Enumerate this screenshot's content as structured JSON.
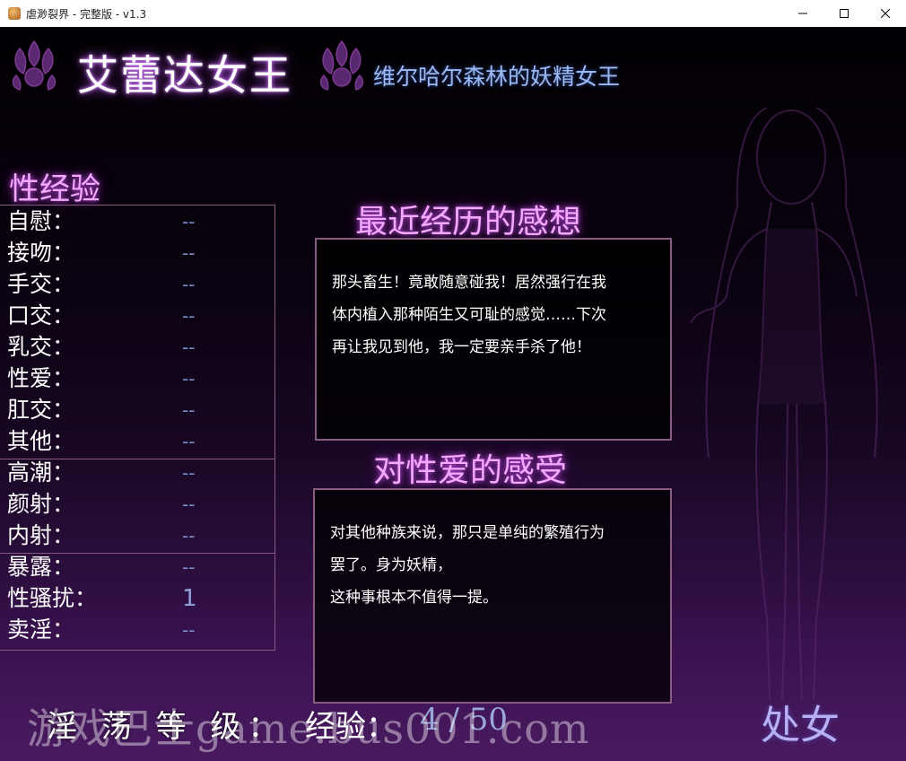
{
  "window": {
    "title": "虐渺裂界 - 完整版 - v1.3",
    "controls": [
      "minimize-icon",
      "maximize-icon",
      "close-icon"
    ]
  },
  "character": {
    "name": "艾蕾达女王",
    "title": "维尔哈尔森林的妖精女王"
  },
  "experience": {
    "heading": "性经验",
    "groups": [
      [
        {
          "label": "自慰：",
          "value": "--"
        },
        {
          "label": "接吻：",
          "value": "--"
        },
        {
          "label": "手交：",
          "value": "--"
        },
        {
          "label": "口交：",
          "value": "--"
        },
        {
          "label": "乳交：",
          "value": "--"
        },
        {
          "label": "性爱：",
          "value": "--"
        },
        {
          "label": "肛交：",
          "value": "--"
        },
        {
          "label": "其他：",
          "value": "--"
        }
      ],
      [
        {
          "label": "高潮：",
          "value": "--"
        },
        {
          "label": "颜射：",
          "value": "--"
        },
        {
          "label": "内射：",
          "value": "--"
        }
      ],
      [
        {
          "label": "暴露：",
          "value": "--"
        },
        {
          "label": "性骚扰：",
          "value": "1"
        },
        {
          "label": "卖淫：",
          "value": "--"
        }
      ]
    ]
  },
  "thoughts": {
    "heading": "最近经历的感想",
    "lines": [
      "那头畜生！竟敢随意碰我！居然强行在我",
      "体内植入那种陌生又可耻的感觉……下次",
      "再让我见到他，我一定要亲手杀了他！"
    ]
  },
  "feelings": {
    "heading": "对性爱的感受",
    "lines": [
      "对其他种族来说，那只是单纯的繁殖行为",
      "罢了。身为妖精，",
      "这种事根本不值得一提。"
    ]
  },
  "footer": {
    "lewd_level_label": "淫 荡 等 级：",
    "exp_label": "经验：",
    "exp_value": "4 / 50",
    "status": "处女"
  },
  "watermark": "游戏巴士game.bus001.com",
  "colors": {
    "accent_pink": "#f4a8ff",
    "title_blue": "#9cb8f0",
    "value_blue": "#7a8ec8",
    "border": "#8a5a82",
    "status": "#b8b0f4"
  }
}
